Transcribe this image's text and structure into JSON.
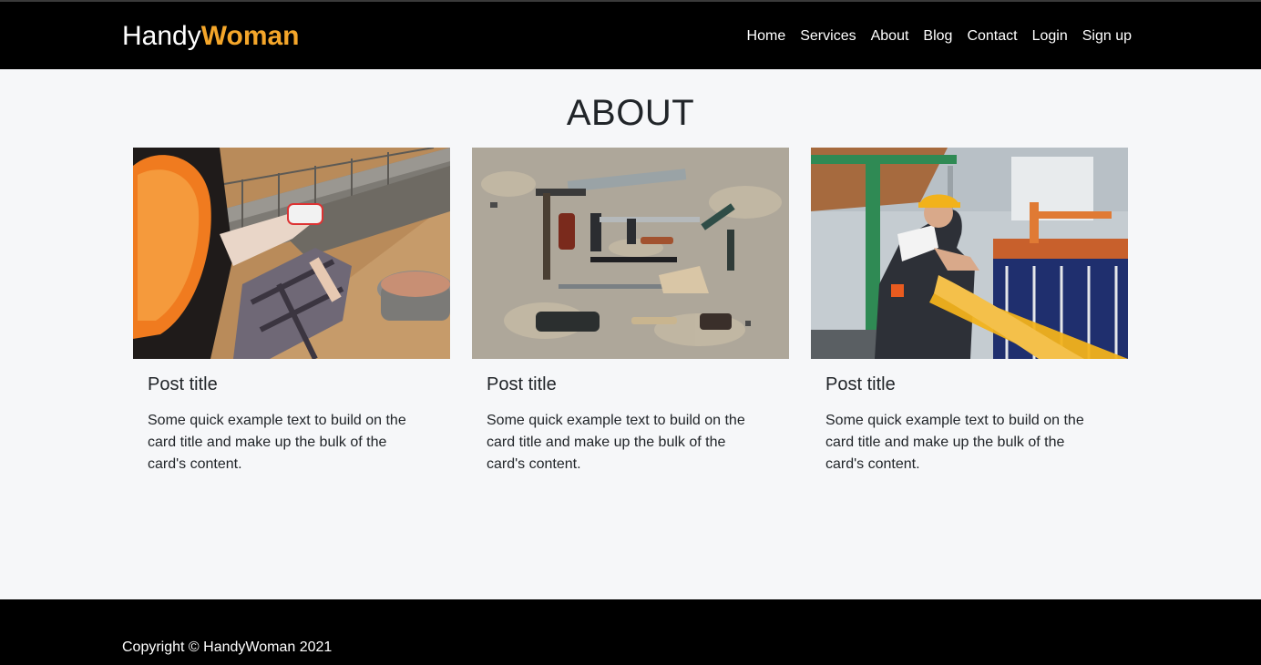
{
  "navbar": {
    "brand_part1": "Handy",
    "brand_part2": "Woman",
    "brand_accent_color": "#f4a62a",
    "links": [
      {
        "label": "Home"
      },
      {
        "label": "Services"
      },
      {
        "label": "About"
      },
      {
        "label": "Blog"
      },
      {
        "label": "Contact"
      },
      {
        "label": "Login"
      },
      {
        "label": "Sign up"
      }
    ]
  },
  "main": {
    "page_title": "ABOUT",
    "cards": [
      {
        "image": "construction-worker-laying-blocks-photo",
        "title": "Post title",
        "text": "Some quick example text to build on the card title and make up the bulk of the card's content."
      },
      {
        "image": "woodworking-tools-flatlay-photo",
        "title": "Post title",
        "text": "Some quick example text to build on the card title and make up the bulk of the card's content."
      },
      {
        "image": "factory-worker-woman-photo",
        "title": "Post title",
        "text": "Some quick example text to build on the card title and make up the bulk of the card's content."
      }
    ]
  },
  "footer": {
    "copyright": "Copyright © HandyWoman 2021"
  }
}
